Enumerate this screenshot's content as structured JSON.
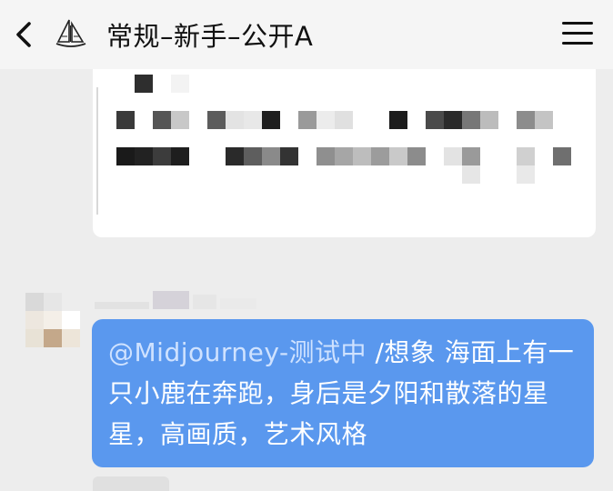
{
  "header": {
    "title": "常规–新手–公开A",
    "back_icon": "chevron-left-icon",
    "menu_icon": "hamburger-menu-icon",
    "avatar_icon": "sailboat-logo-icon"
  },
  "message": {
    "mention": "@Midjourney-测试中",
    "text": " /想象 海面上有一只小鹿在奔跑，身后是夕阳和散落的星星，高画质，艺术风格"
  },
  "colors": {
    "bubble": "#5a98ee",
    "background": "#ededed",
    "header": "#f5f5f5"
  }
}
